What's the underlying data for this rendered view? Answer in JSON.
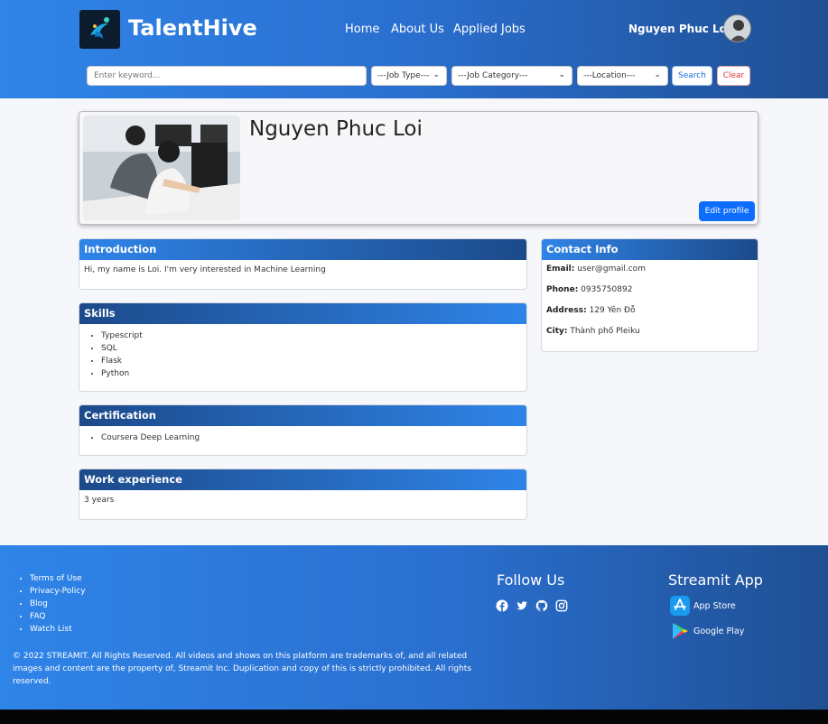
{
  "header": {
    "brand": "TalentHive",
    "nav": [
      "Home",
      "About Us",
      "Applied Jobs"
    ],
    "user_name": "Nguyen Phuc Loi"
  },
  "search": {
    "placeholder": "Enter keyword...",
    "job_type": "---Job Type---",
    "job_category": "---Job Category---",
    "location": "---Location---",
    "search_label": "Search",
    "clear_label": "Clear"
  },
  "profile": {
    "name": "Nguyen Phuc Loi",
    "edit_label": "Edit profile"
  },
  "introduction": {
    "title": "Introduction",
    "text": "Hi, my name is Loi. I'm very interested in Machine Learning"
  },
  "skills": {
    "title": "Skills",
    "items": [
      "Typescript",
      "SQL",
      "Flask",
      "Python"
    ]
  },
  "certification": {
    "title": "Certification",
    "items": [
      "Coursera Deep Learning"
    ]
  },
  "work": {
    "title": "Work experience",
    "text": "3 years"
  },
  "contact": {
    "title": "Contact Info",
    "email_label": "Email:",
    "email": "user@gmail.com",
    "phone_label": "Phone:",
    "phone": "0935750892",
    "address_label": "Address:",
    "address": "129 Yên Đỗ",
    "city_label": "City:",
    "city": "Thành phố Pleiku"
  },
  "footer": {
    "links": [
      "Terms of Use",
      "Privacy-Policy",
      "Blog",
      "FAQ",
      "Watch List"
    ],
    "copyright": "© 2022 STREAMIT. All Rights Reserved. All videos and shows on this platform are trademarks of, and all related images and content are the property of, Streamit Inc. Duplication and copy of this is strictly prohibited. All rights reserved.",
    "follow_title": "Follow Us",
    "socials": [
      "facebook-icon",
      "twitter-icon",
      "github-icon",
      "instagram-icon"
    ],
    "app_title": "Streamit App",
    "app_store": "App Store",
    "google_play": "Google Play"
  },
  "colors": {
    "primary": "#2f84e8",
    "primary_dark": "#1f4f93",
    "button_blue": "#0d6efd",
    "clear_red": "#dd3333"
  }
}
